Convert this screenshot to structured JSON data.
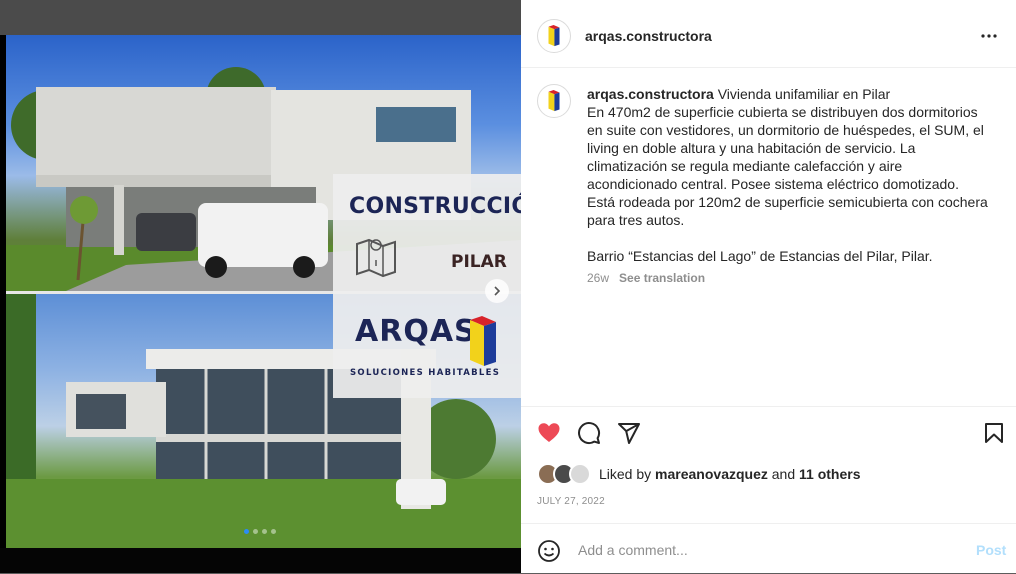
{
  "post": {
    "username": "arqas.constructora",
    "caption_title": "Vivienda unifamiliar en Pilar",
    "caption_body": "En 470m2 de superficie cubierta se distribuyen dos dormitorios en suite con vestidores, un dormitorio de huéspedes, el SUM, el living en doble altura y una habitación de servicio. La climatización se regula mediante calefacción y aire acondicionado central. Posee sistema eléctrico domotizado. Está rodeada por 120m2 de superficie semicubierta con cochera para tres autos.\n\nBarrio “Estancias del Lago” de Estancias del Pilar, Pilar.",
    "age": "26w",
    "see_translation": "See translation",
    "liked_by_prefix": "Liked by",
    "liked_by_user": "mareanovazquez",
    "liked_by_and": "and",
    "liked_by_others": "11 others",
    "date": "JULY 27, 2022",
    "comment_placeholder": "Add a comment...",
    "post_label": "Post",
    "liked": true
  },
  "media": {
    "headline": "CONSTRUCCIÓN",
    "location": "PILAR",
    "brand": "ARQAS",
    "tagline": "SOLUCIONES HABITABLES",
    "slide_count": 4,
    "current_slide": 1
  },
  "icons": {
    "more": "more-horizontal-icon",
    "like": "heart-icon",
    "comment": "comment-icon",
    "share": "share-icon",
    "save": "bookmark-icon",
    "emoji": "emoji-icon",
    "next": "chevron-right-icon"
  },
  "colors": {
    "like_red": "#ed4956",
    "brand_navy": "#1c2556",
    "post_disabled": "#b2dffc",
    "logo_yellow": "#f2d21b",
    "logo_red": "#d8232a",
    "logo_blue": "#1d3c9a"
  }
}
